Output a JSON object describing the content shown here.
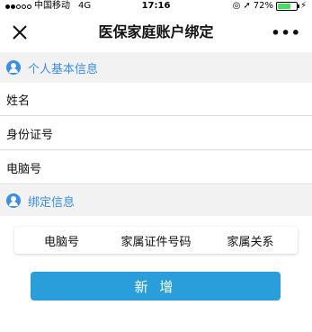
{
  "status_bar": {
    "carrier": "中国移动",
    "network": "4G",
    "time": "17:16",
    "battery_text": "72%",
    "battery_level": 0.72
  },
  "nav": {
    "title": "医保家庭账户绑定",
    "more": "•••"
  },
  "personal_section": {
    "title": "个人基本信息",
    "fields": [
      "姓名",
      "身份证号",
      "电脑号"
    ]
  },
  "binding_section": {
    "title": "绑定信息",
    "columns": [
      "电脑号",
      "家属证件号码",
      "家属关系"
    ]
  },
  "add_button": {
    "label": "新 增"
  },
  "colors": {
    "accent": "#3a8ee6",
    "button": "#2a9ed8",
    "battery": "#4cd964"
  }
}
